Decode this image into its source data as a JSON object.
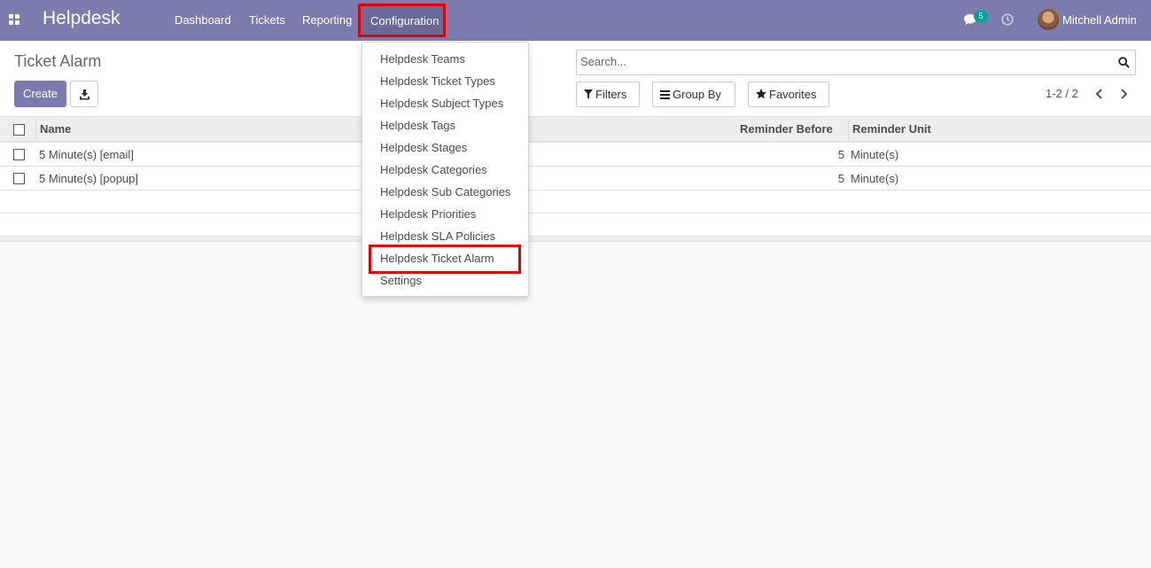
{
  "navbar": {
    "brand": "Helpdesk",
    "menu": [
      "Dashboard",
      "Tickets",
      "Reporting",
      "Configuration"
    ],
    "message_count": "5",
    "user_name": "Mitchell Admin",
    "accent": "#7c7bad"
  },
  "control_panel": {
    "title": "Ticket Alarm",
    "create_label": "Create",
    "search_placeholder": "Search...",
    "filters_label": "Filters",
    "groupby_label": "Group By",
    "favorites_label": "Favorites",
    "pager": "1-2 / 2"
  },
  "list": {
    "columns": [
      "Name",
      "Reminder Before",
      "Reminder Unit"
    ],
    "rows": [
      {
        "name": "5 Minute(s) [email]",
        "reminder_before": "5",
        "reminder_unit": "Minute(s)"
      },
      {
        "name": "5 Minute(s) [popup]",
        "reminder_before": "5",
        "reminder_unit": "Minute(s)"
      }
    ]
  },
  "config_menu": {
    "items": [
      "Helpdesk Teams",
      "Helpdesk Ticket Types",
      "Helpdesk Subject Types",
      "Helpdesk Tags",
      "Helpdesk Stages",
      "Helpdesk Categories",
      "Helpdesk Sub Categories",
      "Helpdesk Priorities",
      "Helpdesk SLA Policies",
      "Helpdesk Ticket Alarm",
      "Settings"
    ],
    "highlight_color": "#e00000"
  },
  "icons": [
    "apps-icon",
    "chat-icon",
    "clock-icon",
    "download-icon",
    "search-icon",
    "filter-icon",
    "list-icon",
    "star-icon",
    "chevron-left-icon",
    "chevron-right-icon"
  ]
}
